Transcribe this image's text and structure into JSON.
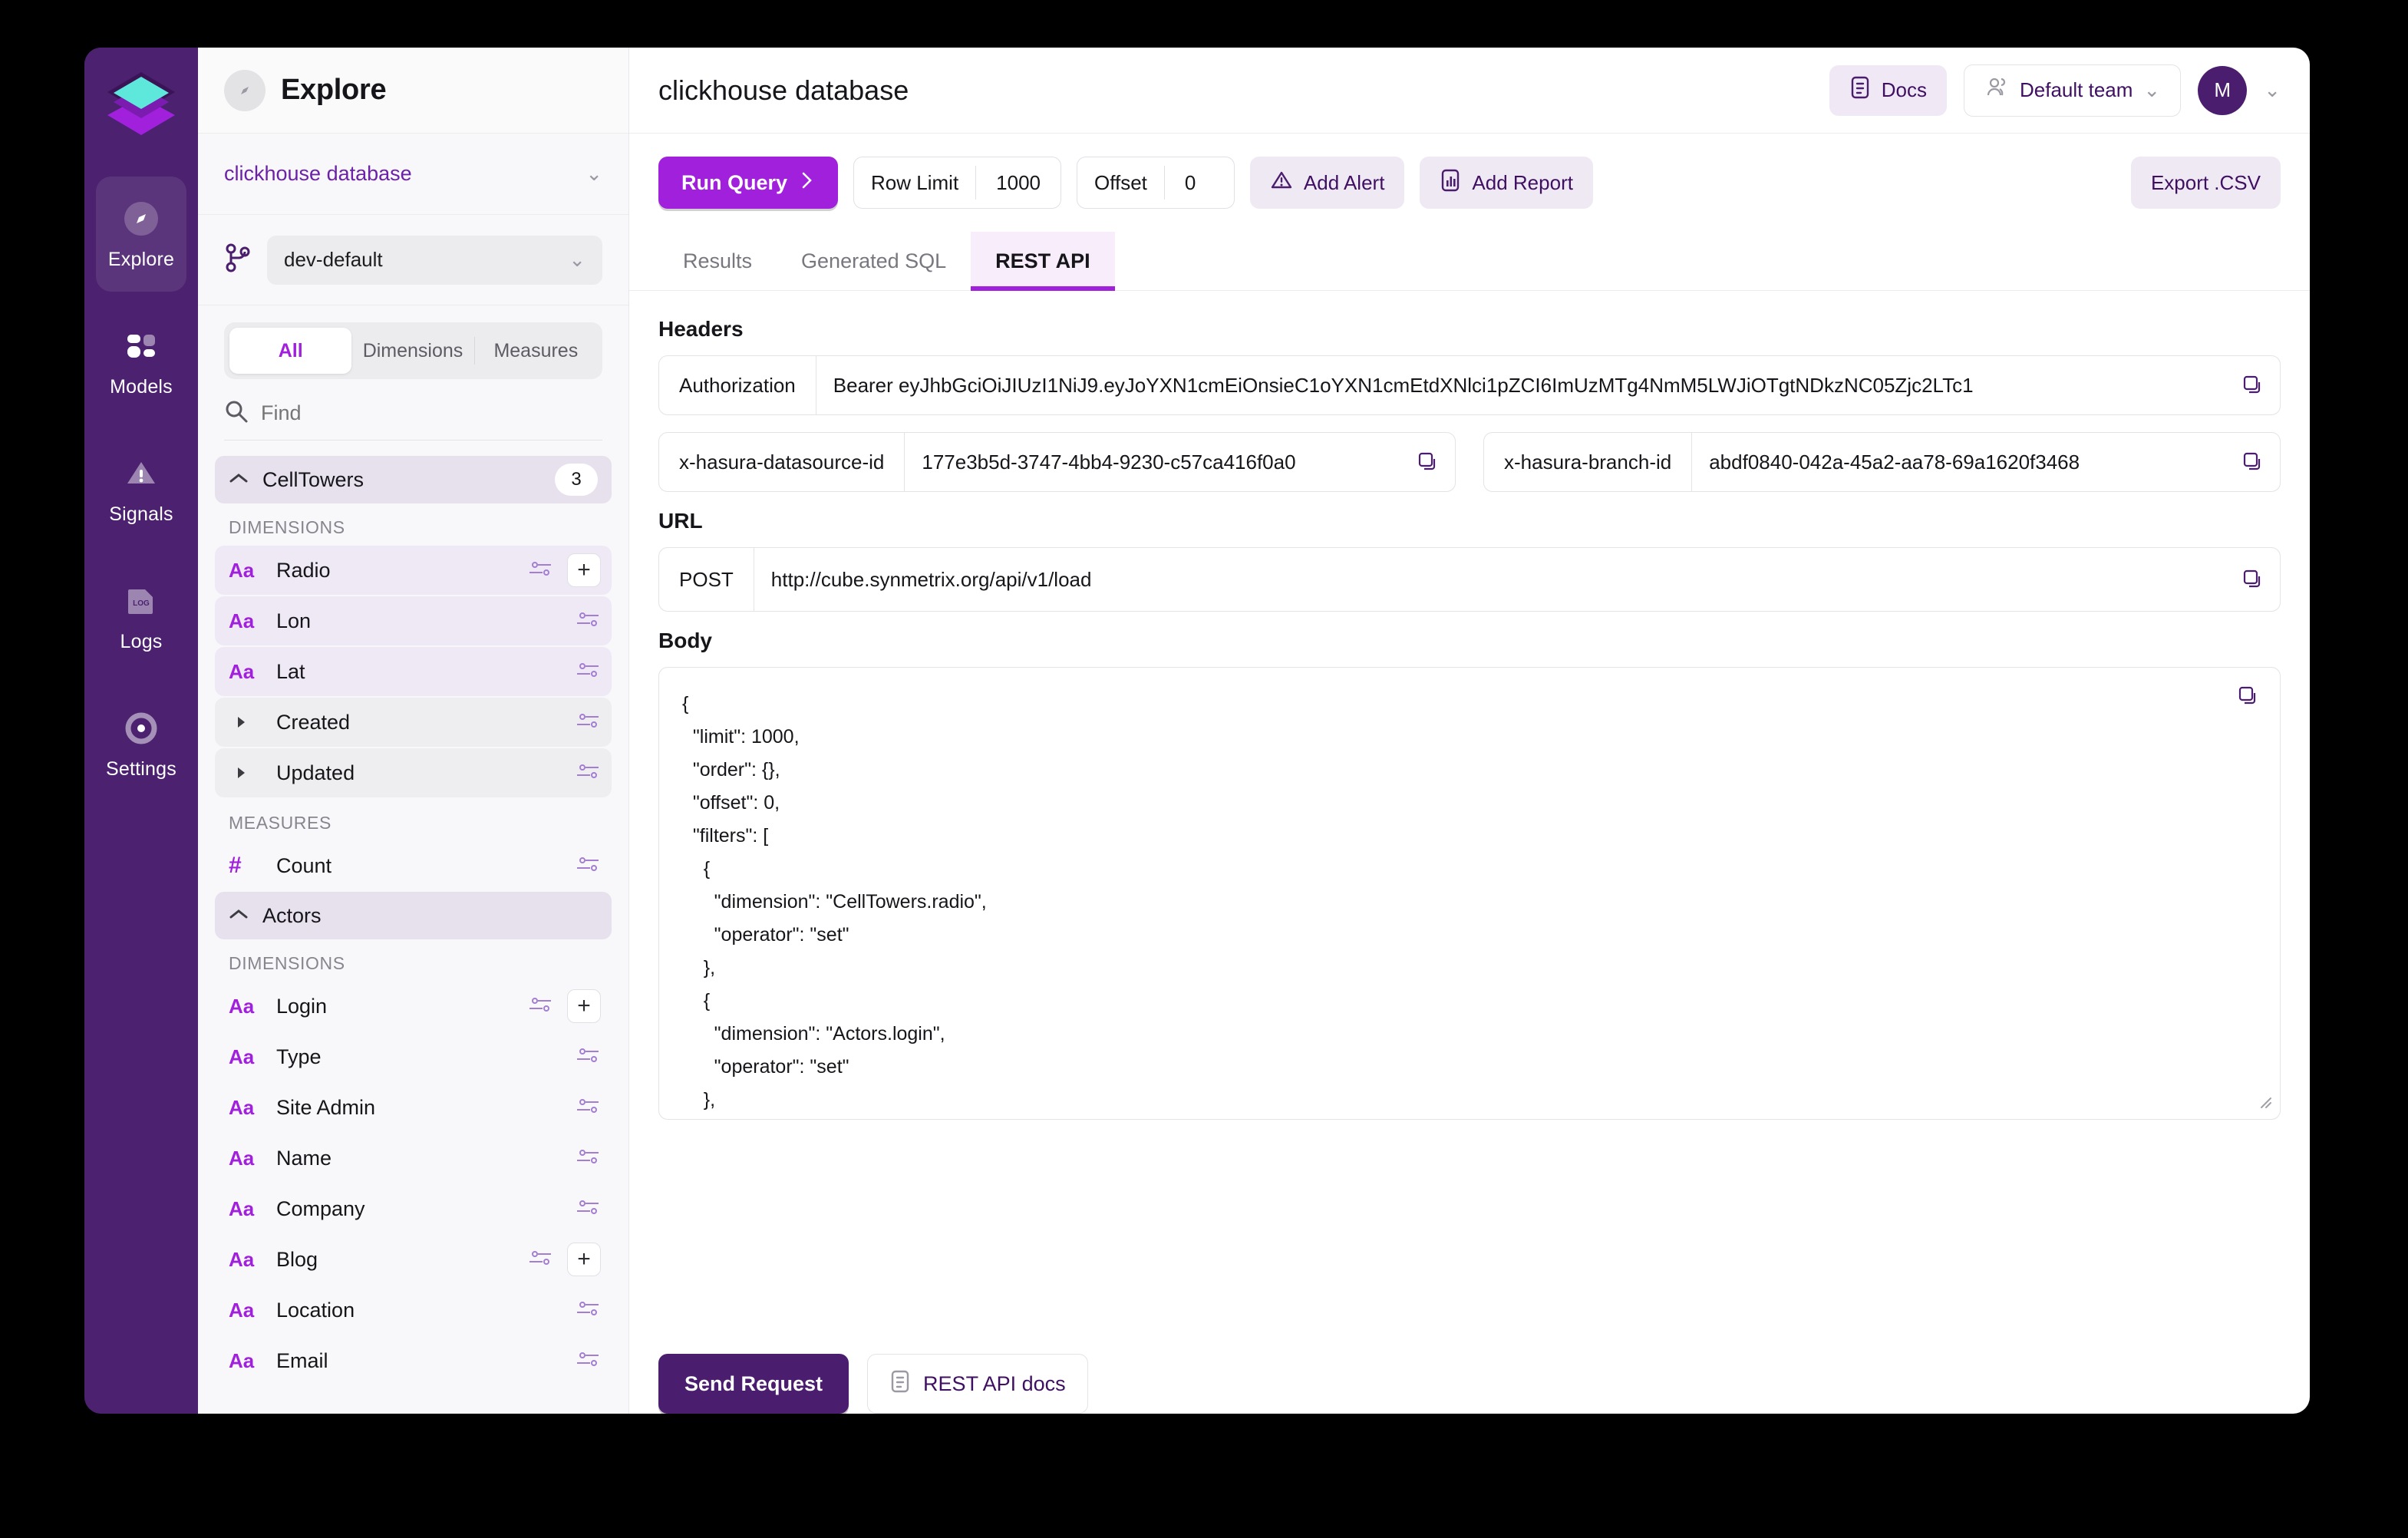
{
  "rail": {
    "logo_icon": "layers-logo-icon",
    "items": [
      {
        "label": "Explore",
        "icon": "compass-icon",
        "active": true
      },
      {
        "label": "Models",
        "icon": "models-icon",
        "active": false
      },
      {
        "label": "Signals",
        "icon": "alert-triangle-icon",
        "active": false
      },
      {
        "label": "Logs",
        "icon": "log-file-icon",
        "active": false
      },
      {
        "label": "Settings",
        "icon": "gear-icon",
        "active": false
      }
    ]
  },
  "sidebar": {
    "title": "Explore",
    "title_icon": "compass-icon",
    "datasource": "clickhouse database",
    "datasource_chevron": "chevron-down-icon",
    "branch_icon": "branch-icon",
    "branch": "dev-default",
    "branch_chevron": "chevron-down-icon",
    "segments": [
      {
        "label": "All",
        "active": true
      },
      {
        "label": "Dimensions",
        "active": false
      },
      {
        "label": "Measures",
        "active": false
      }
    ],
    "search_icon": "search-icon",
    "search_placeholder": "Find",
    "search_value": "",
    "cubes": [
      {
        "name": "CellTowers",
        "count": "3",
        "collapse_icon": "chevron-up-icon",
        "groups": [
          {
            "label": "DIMENSIONS",
            "fields": [
              {
                "name": "Radio",
                "kind": "Aa",
                "tint": "tintA",
                "filter_icon": "filter-icon",
                "add_icon": "plus-icon",
                "has_add": true
              },
              {
                "name": "Lon",
                "kind": "Aa",
                "tint": "tintA",
                "filter_icon": "filter-icon",
                "has_add": false
              },
              {
                "name": "Lat",
                "kind": "Aa",
                "tint": "tintA",
                "filter_icon": "filter-icon",
                "has_add": false
              },
              {
                "name": "Created",
                "kind": "caret",
                "tint": "tintB",
                "filter_icon": "filter-icon",
                "has_add": false
              },
              {
                "name": "Updated",
                "kind": "caret",
                "tint": "tintB",
                "filter_icon": "filter-icon",
                "has_add": false
              }
            ]
          },
          {
            "label": "MEASURES",
            "fields": [
              {
                "name": "Count",
                "kind": "hash",
                "tint": "none",
                "filter_icon": "filter-icon",
                "has_add": false
              }
            ]
          }
        ]
      },
      {
        "name": "Actors",
        "count": "",
        "collapse_icon": "chevron-up-icon",
        "groups": [
          {
            "label": "DIMENSIONS",
            "fields": [
              {
                "name": "Login",
                "kind": "Aa",
                "tint": "none",
                "filter_icon": "filter-icon",
                "add_icon": "plus-icon",
                "has_add": true
              },
              {
                "name": "Type",
                "kind": "Aa",
                "tint": "none",
                "filter_icon": "filter-icon",
                "has_add": false
              },
              {
                "name": "Site Admin",
                "kind": "Aa",
                "tint": "none",
                "filter_icon": "filter-icon",
                "has_add": false
              },
              {
                "name": "Name",
                "kind": "Aa",
                "tint": "none",
                "filter_icon": "filter-icon",
                "has_add": false
              },
              {
                "name": "Company",
                "kind": "Aa",
                "tint": "none",
                "filter_icon": "filter-icon",
                "has_add": false
              },
              {
                "name": "Blog",
                "kind": "Aa",
                "tint": "none",
                "filter_icon": "filter-icon",
                "add_icon": "plus-icon",
                "has_add": true
              },
              {
                "name": "Location",
                "kind": "Aa",
                "tint": "none",
                "filter_icon": "filter-icon",
                "has_add": false
              },
              {
                "name": "Email",
                "kind": "Aa",
                "tint": "none",
                "filter_icon": "filter-icon",
                "has_add": false
              }
            ]
          }
        ]
      }
    ]
  },
  "header": {
    "title": "clickhouse database",
    "docs_label": "Docs",
    "docs_icon": "document-icon",
    "team_label": "Default team",
    "team_icon": "users-icon",
    "team_chevron": "chevron-down-icon",
    "avatar_initial": "M",
    "avatar_chevron": "chevron-down-icon"
  },
  "toolbar": {
    "run_label": "Run Query",
    "run_icon": "chevron-right-icon",
    "row_limit_label": "Row Limit",
    "row_limit_value": "1000",
    "offset_label": "Offset",
    "offset_value": "0",
    "add_alert_label": "Add Alert",
    "add_alert_icon": "alert-triangle-icon",
    "add_report_label": "Add Report",
    "add_report_icon": "bar-chart-icon",
    "export_label": "Export .CSV"
  },
  "tabs": [
    {
      "label": "Results",
      "active": false
    },
    {
      "label": "Generated SQL",
      "active": false
    },
    {
      "label": "REST API",
      "active": true
    }
  ],
  "rest_api": {
    "headers_label": "Headers",
    "copy_icon": "copy-icon",
    "headers": [
      {
        "key": "Authorization",
        "value": "Bearer eyJhbGciOiJIUzI1NiJ9.eyJoYXN1cmEiOnsieC1oYXN1cmEtdXNlci1pZCI6ImUzMTg4NmM5LWJiOTgtNDkzNC05Zjc2LTc1"
      }
    ],
    "header_pair": [
      {
        "key": "x-hasura-datasource-id",
        "value": "177e3b5d-3747-4bb4-9230-c57ca416f0a0"
      },
      {
        "key": "x-hasura-branch-id",
        "value": "abdf0840-042a-45a2-aa78-69a1620f3468"
      }
    ],
    "url_label": "URL",
    "method": "POST",
    "url": "http://cube.synmetrix.org/api/v1/load",
    "body_label": "Body",
    "body": "{\n  \"limit\": 1000,\n  \"order\": {},\n  \"offset\": 0,\n  \"filters\": [\n    {\n      \"dimension\": \"CellTowers.radio\",\n      \"operator\": \"set\"\n    },\n    {\n      \"dimension\": \"Actors.login\",\n      \"operator\": \"set\"\n    },",
    "resize_icon": "resize-handle-icon",
    "send_label": "Send Request",
    "docs_label": "REST API docs",
    "docs_icon": "document-icon"
  },
  "colors": {
    "brand_purple": "#a020dc",
    "deep_purple": "#4b1d6e",
    "rail_purple": "#4b2170"
  }
}
